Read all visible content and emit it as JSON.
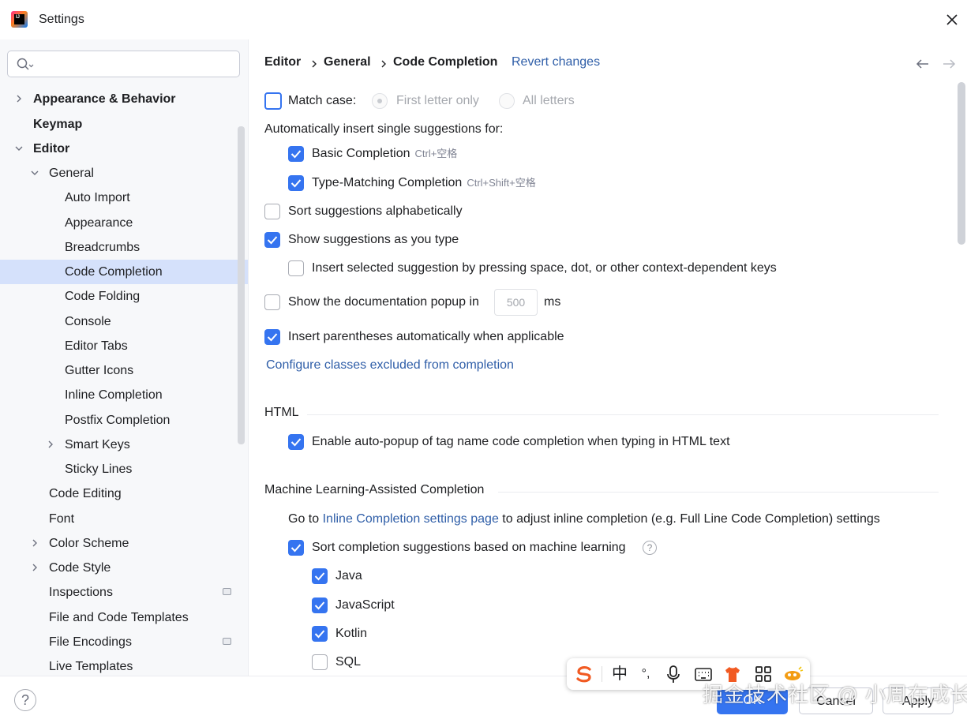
{
  "window": {
    "title": "Settings",
    "app_logo_text": "IJ"
  },
  "sidebar": {
    "search_placeholder": "",
    "items": [
      {
        "label": "Appearance & Behavior"
      },
      {
        "label": "Keymap"
      },
      {
        "label": "Editor"
      },
      {
        "label": "General"
      },
      {
        "label": "Auto Import"
      },
      {
        "label": "Appearance"
      },
      {
        "label": "Breadcrumbs"
      },
      {
        "label": "Code Completion"
      },
      {
        "label": "Code Folding"
      },
      {
        "label": "Console"
      },
      {
        "label": "Editor Tabs"
      },
      {
        "label": "Gutter Icons"
      },
      {
        "label": "Inline Completion"
      },
      {
        "label": "Postfix Completion"
      },
      {
        "label": "Smart Keys"
      },
      {
        "label": "Sticky Lines"
      },
      {
        "label": "Code Editing"
      },
      {
        "label": "Font"
      },
      {
        "label": "Color Scheme"
      },
      {
        "label": "Code Style"
      },
      {
        "label": "Inspections"
      },
      {
        "label": "File and Code Templates"
      },
      {
        "label": "File Encodings"
      },
      {
        "label": "Live Templates"
      }
    ]
  },
  "breadcrumb": {
    "items": [
      "Editor",
      "General",
      "Code Completion"
    ],
    "revert": "Revert changes"
  },
  "settings": {
    "match_case": {
      "label": "Match case:",
      "checked": false
    },
    "first_letter_only": "First letter only",
    "all_letters": "All letters",
    "auto_insert_header": "Automatically insert single suggestions for:",
    "basic_completion": {
      "label": "Basic Completion",
      "shortcut": "Ctrl+空格",
      "checked": true
    },
    "type_matching": {
      "label": "Type-Matching Completion",
      "shortcut": "Ctrl+Shift+空格",
      "checked": true
    },
    "sort_alpha": {
      "label": "Sort suggestions alphabetically",
      "checked": false
    },
    "show_as_type": {
      "label": "Show suggestions as you type",
      "checked": true
    },
    "insert_selected": {
      "label": "Insert selected suggestion by pressing space, dot, or other context-dependent keys",
      "checked": false
    },
    "doc_popup": {
      "label": "Show the documentation popup in",
      "value": "500",
      "unit": "ms",
      "checked": false
    },
    "insert_parens": {
      "label": "Insert parentheses automatically when applicable",
      "checked": true
    },
    "configure_link": "Configure classes excluded from completion",
    "html_section": "HTML",
    "html_autopopup": {
      "label": "Enable auto-popup of tag name code completion when typing in HTML text",
      "checked": true
    },
    "ml_section": "Machine Learning-Assisted Completion",
    "ml_goto_prefix": "Go to",
    "ml_goto_link": "Inline Completion settings page",
    "ml_goto_suffix": "to adjust inline completion (e.g. Full Line Code Completion) settings",
    "ml_sort": {
      "label": "Sort completion suggestions based on machine learning",
      "checked": true
    },
    "ml_help": "?",
    "langs": [
      {
        "label": "Java",
        "checked": true
      },
      {
        "label": "JavaScript",
        "checked": true
      },
      {
        "label": "Kotlin",
        "checked": true
      },
      {
        "label": "SQL",
        "checked": false
      }
    ]
  },
  "footer": {
    "help": "?",
    "ok": "OK",
    "cancel": "Cancel",
    "apply": "Apply"
  },
  "ime_toolbar": {
    "lang": "中",
    "punct": "°,"
  },
  "watermark": "掘金技术社区 @ 小周在成长"
}
